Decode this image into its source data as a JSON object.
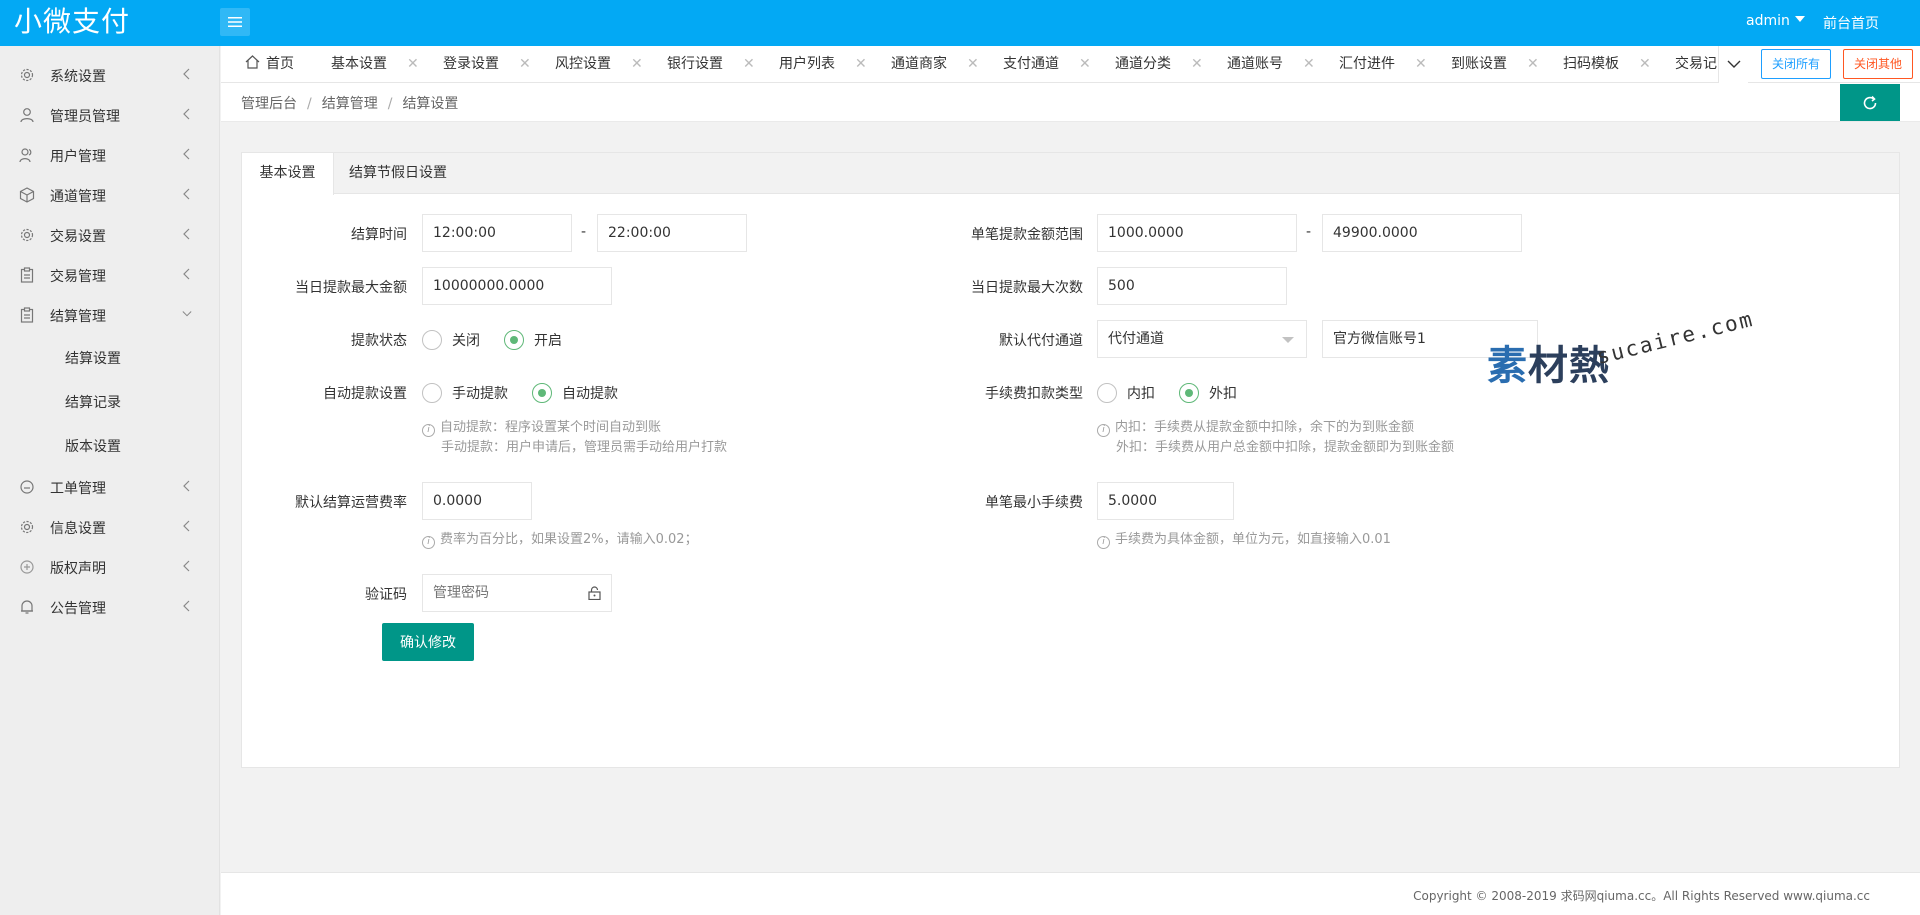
{
  "header": {
    "logo": "小微支付",
    "user": "admin",
    "front_link": "前台首页"
  },
  "sidebar": {
    "items": [
      {
        "label": "系统设置",
        "icon": "gear-icon"
      },
      {
        "label": "管理员管理",
        "icon": "user-icon"
      },
      {
        "label": "用户管理",
        "icon": "users-icon"
      },
      {
        "label": "通道管理",
        "icon": "cube-icon"
      },
      {
        "label": "交易设置",
        "icon": "gear-icon"
      },
      {
        "label": "交易管理",
        "icon": "clipboard-icon"
      },
      {
        "label": "结算管理",
        "icon": "clipboard-icon"
      },
      {
        "label": "工单管理",
        "icon": "circle-icon"
      },
      {
        "label": "信息设置",
        "icon": "gear-icon"
      },
      {
        "label": "版权声明",
        "icon": "plus-circle-icon"
      },
      {
        "label": "公告管理",
        "icon": "bell-icon"
      }
    ],
    "sub_items": [
      "结算设置",
      "结算记录",
      "版本设置"
    ]
  },
  "tabs": [
    "首页",
    "基本设置",
    "登录设置",
    "风控设置",
    "银行设置",
    "用户列表",
    "通道商家",
    "支付通道",
    "通道分类",
    "通道账号",
    "汇付进件",
    "到账设置",
    "扫码模板",
    "交易记"
  ],
  "tab_actions": {
    "close_all": "关闭所有",
    "close_other": "关闭其他"
  },
  "breadcrumb": [
    "管理后台",
    "结算管理",
    "结算设置"
  ],
  "card_tabs": [
    "基本设置",
    "结算节假日设置"
  ],
  "form": {
    "settle_time_label": "结算时间",
    "settle_time_start": "12:00:00",
    "settle_time_end": "22:00:00",
    "dash": "-",
    "single_amount_label": "单笔提款金额范围",
    "single_amount_min": "1000.0000",
    "single_amount_max": "49900.0000",
    "daily_max_amount_label": "当日提款最大金额",
    "daily_max_amount": "10000000.0000",
    "daily_max_count_label": "当日提款最大次数",
    "daily_max_count": "500",
    "withdraw_status_label": "提款状态",
    "withdraw_status_off": "关闭",
    "withdraw_status_on": "开启",
    "default_channel_label": "默认代付通道",
    "default_channel": "代付通道",
    "default_account": "官方微信账号1",
    "auto_withdraw_label": "自动提款设置",
    "auto_withdraw_manual": "手动提款",
    "auto_withdraw_auto": "自动提款",
    "auto_hint_1": "自动提款：程序设置某个时间自动到账",
    "auto_hint_2": "手动提款：用户申请后，管理员需手动给用户打款",
    "fee_type_label": "手续费扣款类型",
    "fee_type_inner": "内扣",
    "fee_type_outer": "外扣",
    "fee_hint_1": "内扣：手续费从提款金额中扣除，余下的为到账金额",
    "fee_hint_2": "外扣：手续费从用户总金额中扣除，提款金额即为到账金额",
    "rate_label": "默认结算运营费率",
    "rate_value": "0.0000",
    "rate_hint": "费率为百分比，如果设置2%，请输入0.02；",
    "min_fee_label": "单笔最小手续费",
    "min_fee_value": "5.0000",
    "min_fee_hint": "手续费为具体金额，单位为元，如直接输入0.01",
    "captcha_label": "验证码",
    "captcha_placeholder": "管理密码",
    "submit": "确认修改"
  },
  "watermark": {
    "brand_blue": "素",
    "brand_rest": "材熱",
    "url": "sucaire.com"
  },
  "footer": "Copyright © 2008-2019 求码网qiuma.cc。All Rights Reserved www.qiuma.cc",
  "colors": {
    "header": "#03a9f4",
    "primary_btn": "#009688",
    "radio_on": "#5fb878",
    "close_all": "#1e9fff",
    "close_other": "#ff5722"
  }
}
